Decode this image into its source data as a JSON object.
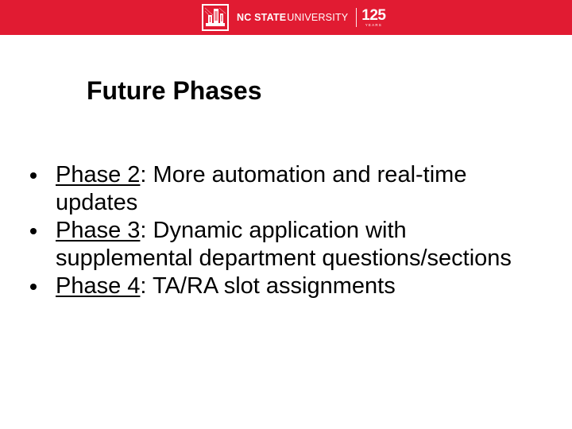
{
  "header": {
    "brand_bold": "NC STATE",
    "brand_light": "UNIVERSITY",
    "anniversary_number": "125",
    "anniversary_label": "YEARS",
    "logo_icon": "belltower-icon",
    "brand_color": "#e11b32"
  },
  "slide": {
    "title": "Future Phases",
    "bullets": [
      {
        "phase": "Phase 2",
        "separator": ":",
        "text": " More automation and real-time updates"
      },
      {
        "phase": "Phase 3",
        "separator": ":",
        "text": " Dynamic application with supplemental department questions/sections"
      },
      {
        "phase": "Phase 4",
        "separator": ":",
        "text": " TA/RA slot assignments"
      }
    ]
  }
}
